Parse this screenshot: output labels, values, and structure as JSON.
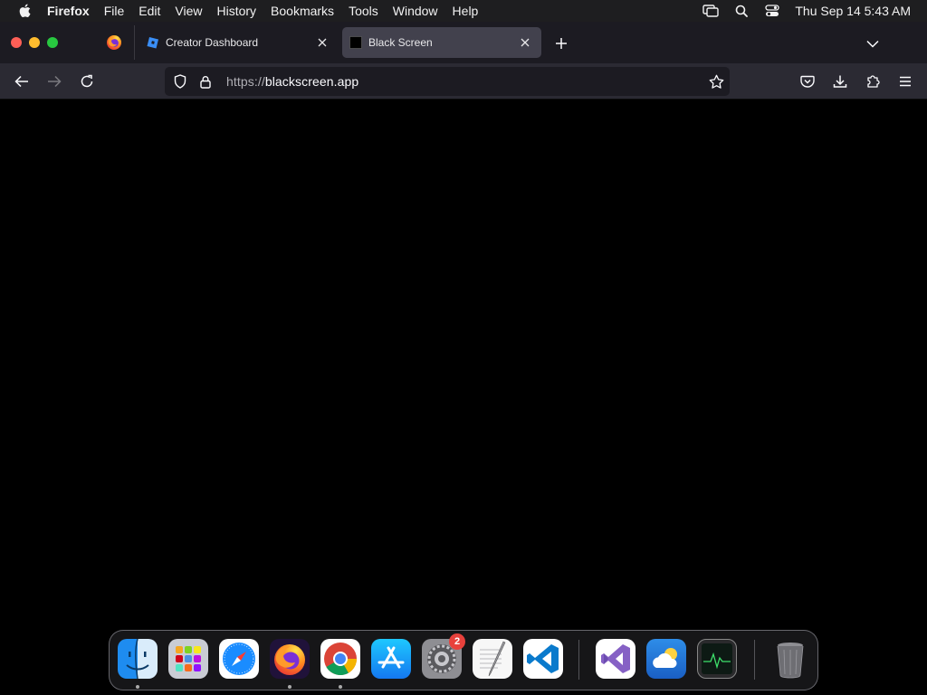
{
  "menubar": {
    "app_name": "Firefox",
    "items": [
      "File",
      "Edit",
      "View",
      "History",
      "Bookmarks",
      "Tools",
      "Window",
      "Help"
    ],
    "clock": "Thu Sep 14  5:43 AM"
  },
  "tabs": [
    {
      "label": "Creator Dashboard",
      "icon": "roblox-studio-icon",
      "active": false
    },
    {
      "label": "Black Screen",
      "icon": "black-square-icon",
      "active": true
    }
  ],
  "urlbar": {
    "scheme": "https://",
    "host": "blackscreen.app"
  },
  "dock": {
    "badges": {
      "system_settings": "2"
    },
    "items": [
      "finder-icon",
      "launchpad-icon",
      "safari-icon",
      "firefox-icon",
      "chrome-icon",
      "app-store-icon",
      "system-settings-icon",
      "textedit-icon",
      "vscode-icon",
      "visual-studio-icon",
      "weather-icon",
      "activity-monitor-icon",
      "trash-icon"
    ]
  },
  "colors": {
    "tabstrip": "#1c1b22",
    "navbar": "#2b2a33",
    "active_tab": "#42414d",
    "content": "#000000"
  }
}
